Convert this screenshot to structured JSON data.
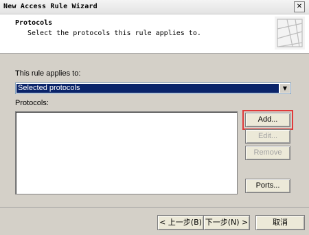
{
  "window": {
    "title": "New Access Rule Wizard",
    "close_glyph": "✕"
  },
  "header": {
    "title": "Protocols",
    "subtitle": "Select the protocols this rule applies to.",
    "graphic_icon": "wizard-graphic-icon"
  },
  "form": {
    "applies_label": "This rule applies to:",
    "applies_value": "Selected protocols",
    "protocols_label": "Protocols:"
  },
  "buttons": {
    "add": "Add...",
    "edit": "Edit...",
    "remove": "Remove",
    "ports": "Ports..."
  },
  "footer": {
    "back": "< 上一步(B)",
    "next": "下一步(N) >",
    "cancel": "取消"
  },
  "colors": {
    "selection": "#0a246a",
    "highlight_border": "#e03a3a",
    "dialog_bg": "#d4d0c8"
  }
}
